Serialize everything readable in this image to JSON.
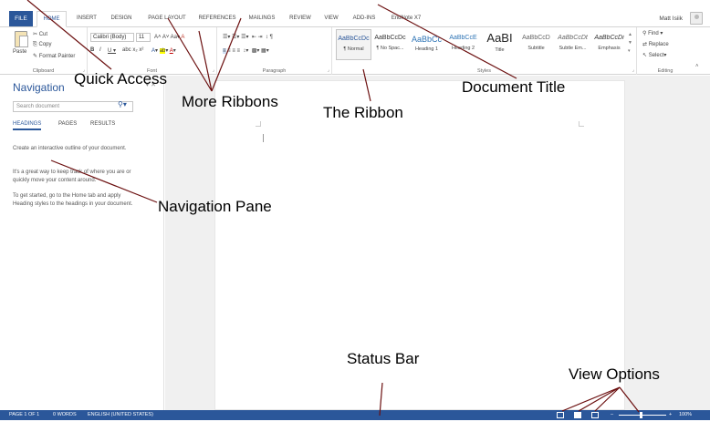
{
  "tabs": {
    "file": "FILE",
    "items": [
      "HOME",
      "INSERT",
      "DESIGN",
      "PAGE LAYOUT",
      "REFERENCES",
      "MAILINGS",
      "REVIEW",
      "VIEW",
      "ADD-INS",
      "EndNote X7"
    ],
    "active": "HOME"
  },
  "user": {
    "name": "Matt Isiik"
  },
  "ribbon": {
    "clipboard": {
      "paste": "Paste",
      "cut": "Cut",
      "copy": "Copy",
      "format_painter": "Format Painter",
      "label": "Clipboard"
    },
    "font": {
      "name": "Calibri (Body)",
      "size": "11",
      "label": "Font"
    },
    "paragraph": {
      "label": "Paragraph"
    },
    "styles": {
      "label": "Styles",
      "items": [
        {
          "sample": "AaBbCcDc",
          "name": "¶ Normal"
        },
        {
          "sample": "AaBbCcDc",
          "name": "¶ No Spac..."
        },
        {
          "sample": "AaBbCc",
          "name": "Heading 1"
        },
        {
          "sample": "AaBbCcE",
          "name": "Heading 2"
        },
        {
          "sample": "AaBI",
          "name": "Title"
        },
        {
          "sample": "AaBbCcD",
          "name": "Subtitle"
        },
        {
          "sample": "AaBbCcDt",
          "name": "Subtle Em..."
        },
        {
          "sample": "AaBbCcDi",
          "name": "Emphasis"
        }
      ]
    },
    "editing": {
      "find": "Find",
      "replace": "Replace",
      "select": "Select",
      "label": "Editing"
    }
  },
  "navigation": {
    "title": "Navigation",
    "search_placeholder": "Search document",
    "tabs": [
      "HEADINGS",
      "PAGES",
      "RESULTS"
    ],
    "text1": "Create an interactive outline of your document.",
    "text2": "It's a great way to keep track of where you are or quickly move your content around.",
    "text3": "To get started, go to the Home tab and apply Heading styles to the headings in your document."
  },
  "status": {
    "page": "PAGE 1 OF 1",
    "words": "0 WORDS",
    "language": "ENGLISH (UNITED STATES)",
    "zoom": "100%"
  },
  "callouts": {
    "quick_access": "Quick Access",
    "more_ribbons": "More Ribbons",
    "the_ribbon": "The Ribbon",
    "document_title": "Document Title",
    "navigation_pane": "Navigation Pane",
    "status_bar": "Status Bar",
    "view_options": "View Options"
  },
  "colors": {
    "accent": "#2b579a"
  }
}
